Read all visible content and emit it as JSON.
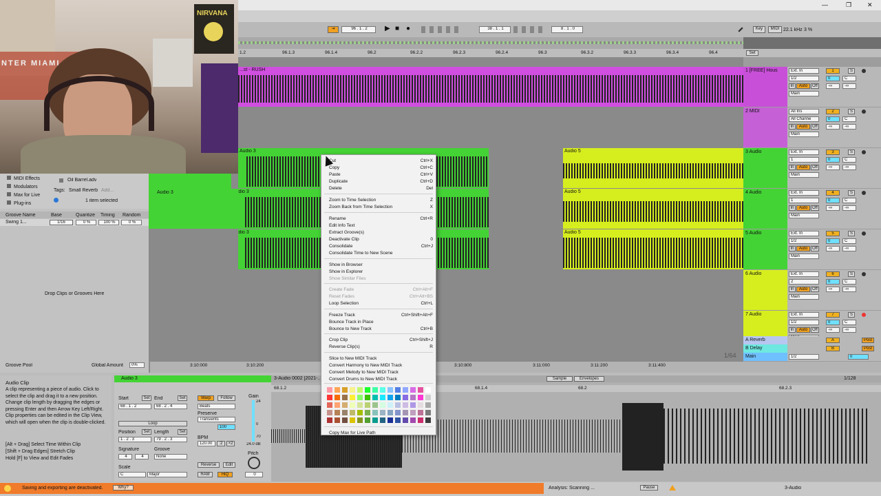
{
  "webcam": {
    "poster_text": "NIRVANA",
    "banner_text": "NTER MIAMI"
  },
  "titlebar": {
    "minimize": "—",
    "restore": "❐",
    "close": "✕"
  },
  "transport": {
    "follow": "⇥",
    "tempo": "96 . 1 . 2",
    "play": "▶",
    "stop": "■",
    "record": "●",
    "position": "38 . 1 . 1",
    "loop_end": "8 . 1 . 0",
    "key": "Key",
    "midi": "MIDI",
    "sample_rate": "22.1 kHz",
    "cpu": "3 %"
  },
  "ruler": {
    "ticks": [
      "1.2",
      "96.1.3",
      "96.1.4",
      "96.2",
      "96.2.2",
      "96.2.3",
      "96.2.4",
      "96.3",
      "96.3.2",
      "96.3.3",
      "96.3.4",
      "96.4"
    ],
    "set_label": "Set"
  },
  "clips": {
    "rush": "...st - RUSH",
    "audio3": "Audio 3",
    "audio5": "Audio 5"
  },
  "tracks": [
    {
      "name": "1 [FREE] Hous",
      "input": "Ext. In",
      "channel": "1/2",
      "num": "1",
      "vol": "0",
      "pan": "C",
      "main": "Main",
      "color": "#c84fd8"
    },
    {
      "name": "2 MIDI",
      "input": "All Ins",
      "channel": "All Channe",
      "num": "2",
      "vol": "0",
      "pan": "C",
      "main": "Main",
      "color": "#c560d6"
    },
    {
      "name": "3 Audio",
      "input": "Ext. In",
      "channel": "1",
      "num": "3",
      "vol": "0",
      "pan": "C",
      "main": "Main",
      "color": "#44d335"
    },
    {
      "name": "4 Audio",
      "input": "Ext. In",
      "channel": "1",
      "num": "4",
      "vol": "0",
      "pan": "C",
      "main": "Main",
      "color": "#44d335"
    },
    {
      "name": "5 Audio",
      "input": "Ext. In",
      "channel": "1/2",
      "num": "5",
      "vol": "0",
      "pan": "C",
      "main": "Main",
      "color": "#44d335"
    },
    {
      "name": "6 Audio",
      "input": "Ext. In",
      "channel": "2",
      "num": "6",
      "vol": "0",
      "pan": "C",
      "main": "Main",
      "color": "#d6ee1e"
    },
    {
      "name": "7 Audio",
      "input": "Ext. In",
      "channel": "1/2",
      "num": "7",
      "vol": "0",
      "pan": "C",
      "main": "Main",
      "color": "#d6ee1e"
    }
  ],
  "returns": [
    {
      "name": "A Reverb",
      "letter": "A",
      "post": "Post"
    },
    {
      "name": "B Delay",
      "letter": "B",
      "post": "Post"
    }
  ],
  "main_track": {
    "name": "Main",
    "channel": "1/2",
    "value": "0"
  },
  "track_common": {
    "in": "In",
    "auto": "Auto",
    "off": "Off",
    "inf": "-∞",
    "s": "S"
  },
  "browser": {
    "categories": [
      "MIDI Effects",
      "Modulators",
      "Max for Live",
      "Plug-ins"
    ],
    "file": "Oil Barrel.adv",
    "tags_label": "Tags:",
    "tag": "Small Reverb",
    "add": "Add...",
    "items_selected": "1 item selected"
  },
  "groove": {
    "headers": [
      "Groove Name",
      "Base",
      "Quantize",
      "Timing",
      "Random"
    ],
    "row": {
      "name": "Swing 1...",
      "base": "1/16",
      "quantize": "0 %",
      "timing": "100 %",
      "random": "0 %"
    },
    "drop_text": "Drop Clips or Grooves Here",
    "pool_label": "Groove Pool",
    "global_amount_label": "Global Amount",
    "global_amount": "0%"
  },
  "timeline": {
    "marks": [
      "3:10:000",
      "3:10:200",
      "3:10:800",
      "3:11:000",
      "3:11:200",
      "3:11:400"
    ],
    "zoom": "1/64"
  },
  "info": {
    "title": "Audio Clip",
    "body": "A clip representing a piece of audio. Click to select the clip and drag it to a new position. Change clip length by dragging the edges or pressing Enter and then Arrow Key Left/Right. Clip properties can be edited in the Clip View, which will open when the clip is double-clicked.",
    "hints": [
      "[Alt + Drag] Select Time Within Clip",
      "[Shift + Drag Edges] Stretch Clip",
      "Hold [F] to View and Edit Fades"
    ]
  },
  "clipview": {
    "clip_name": "Audio 3",
    "sample_name": "3-Audio 0002 [2021-...",
    "start_label": "Start",
    "end_label": "End",
    "set": "Set",
    "start": "68 . 1 . 2",
    "end": "68 . 2 . 4",
    "loop": "Loop",
    "position_label": "Position",
    "length_label": "Length",
    "position": "1 . 2 . 3",
    "length": "79 . 2 . 3",
    "signature_label": "Signature",
    "sig_num": "4",
    "sig_den": "4",
    "groove_label": "Groove",
    "groove": "None",
    "scale_label": "Scale",
    "scale_root": "C",
    "scale_mode": "Major",
    "warp": "Warp",
    "follow": "Follow",
    "warp_mode": "Beats",
    "preserve_label": "Preserve",
    "preserve": "Transients",
    "bpm_label": "BPM",
    "bpm": "120.00",
    "half": ":2",
    "double": "×2",
    "pct": "100",
    "reverse": "Reverse",
    "edit": "Edit",
    "ram": "RAM",
    "hiq": "HiQ",
    "gain_label": "Gain",
    "gain": "24.0 dB",
    "gain_top": "24",
    "gain_mid": "0",
    "gain_low": "70",
    "pitch_label": "Pitch",
    "pitch": "0",
    "detune": "0",
    "sample_tab": "Sample",
    "envelopes_tab": "Envelopes",
    "grid": "1/128",
    "ruler": [
      "68.1.2",
      "68.1.4",
      "68.2",
      "68.2.3"
    ]
  },
  "context_menu": [
    {
      "label": "Cut",
      "shortcut": "Ctrl+X"
    },
    {
      "label": "Copy",
      "shortcut": "Ctrl+C"
    },
    {
      "label": "Paste",
      "shortcut": "Ctrl+V"
    },
    {
      "label": "Duplicate",
      "shortcut": "Ctrl+D"
    },
    {
      "label": "Delete",
      "shortcut": "Del"
    },
    {
      "label": "Zoom to Time Selection",
      "shortcut": "Z"
    },
    {
      "label": "Zoom Back from Time Selection",
      "shortcut": "X"
    },
    {
      "label": "Rename",
      "shortcut": "Ctrl+R"
    },
    {
      "label": "Edit Info Text",
      "shortcut": ""
    },
    {
      "label": "Extract Groove(s)",
      "shortcut": ""
    },
    {
      "label": "Deactivate Clip",
      "shortcut": "0"
    },
    {
      "label": "Consolidate",
      "shortcut": "Ctrl+J"
    },
    {
      "label": "Consolidate Time to New Scene",
      "shortcut": ""
    },
    {
      "label": "Show in Browser",
      "shortcut": ""
    },
    {
      "label": "Show in Explorer",
      "shortcut": ""
    },
    {
      "label": "Show Similar Files",
      "shortcut": "",
      "disabled": true
    },
    {
      "label": "Create Fade",
      "shortcut": "Ctrl+Alt+F",
      "disabled": true
    },
    {
      "label": "Reset Fades",
      "shortcut": "Ctrl+Alt+BS",
      "disabled": true
    },
    {
      "label": "Loop Selection",
      "shortcut": "Ctrl+L"
    },
    {
      "label": "Freeze Track",
      "shortcut": "Ctrl+Shift+Alt+F"
    },
    {
      "label": "Bounce Track in Place",
      "shortcut": ""
    },
    {
      "label": "Bounce to New Track",
      "shortcut": "Ctrl+B"
    },
    {
      "label": "Crop Clip",
      "shortcut": "Ctrl+Shift+J"
    },
    {
      "label": "Reverse Clip(s)",
      "shortcut": "R"
    },
    {
      "label": "Slice to New MIDI Track",
      "shortcut": ""
    },
    {
      "label": "Convert Harmony to New MIDI Track",
      "shortcut": ""
    },
    {
      "label": "Convert Melody to New MIDI Track",
      "shortcut": ""
    },
    {
      "label": "Convert Drums to New MIDI Track",
      "shortcut": ""
    },
    {
      "label": "Copy Max for Live Path",
      "shortcut": ""
    }
  ],
  "palette": [
    "#ff9aa5",
    "#ffa557",
    "#d8a02a",
    "#f7f28c",
    "#c4f76e",
    "#1eff2d",
    "#3fffa6",
    "#5cffe9",
    "#8bc4ff",
    "#5480e4",
    "#92a7ff",
    "#d86ce4",
    "#e553a0",
    "#ffffff",
    "#ff3636",
    "#f66c03",
    "#99724a",
    "#fff034",
    "#87ff67",
    "#3dc300",
    "#00bfaf",
    "#19e9ff",
    "#10a4ee",
    "#007dc0",
    "#886ce4",
    "#b677c6",
    "#ff39d4",
    "#d0d0d0",
    "#e2675a",
    "#ffa374",
    "#d3ad71",
    "#eeffb7",
    "#d3e498",
    "#bad074",
    "#9bc48d",
    "#d4fde1",
    "#cdf1f8",
    "#b9c1e3",
    "#cdbbe4",
    "#ae98e5",
    "#e5dce1",
    "#a9a9a9",
    "#c6928b",
    "#b78256",
    "#99836a",
    "#bfba69",
    "#a6be00",
    "#7db04d",
    "#88c2ba",
    "#9bb3c4",
    "#85a5c2",
    "#8393cc",
    "#a595b5",
    "#bf9fbe",
    "#bc7196",
    "#7b7b7b",
    "#af3333",
    "#a95131",
    "#724f41",
    "#dbc300",
    "#85961f",
    "#539f31",
    "#0a9c8e",
    "#236384",
    "#1a2f96",
    "#2f52a2",
    "#624bad",
    "#a34bad",
    "#cc2e6e",
    "#3c3c3c"
  ],
  "status": {
    "message": "Saving and exporting are deactivated.",
    "why": "Why?",
    "analysis": "Analysis: Scanning ...",
    "pause": "Pause",
    "track": "3-Audio"
  }
}
